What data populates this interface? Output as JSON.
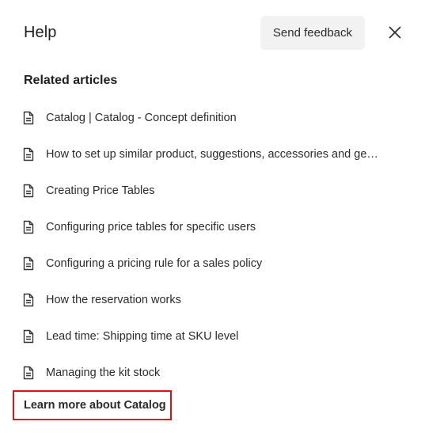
{
  "header": {
    "title": "Help",
    "feedback_label": "Send feedback",
    "close_icon": "close-icon"
  },
  "related": {
    "section_title": "Related articles",
    "items": [
      {
        "label": "Catalog | Catalog - Concept definition",
        "icon": "document-icon"
      },
      {
        "label": "How to set up similar product, suggestions, accessories and ge…",
        "icon": "document-icon"
      },
      {
        "label": "Creating Price Tables",
        "icon": "document-icon"
      },
      {
        "label": "Configuring price tables for specific users",
        "icon": "document-icon"
      },
      {
        "label": "Configuring a pricing rule for a sales policy",
        "icon": "document-icon"
      },
      {
        "label": "How the reservation works",
        "icon": "document-icon"
      },
      {
        "label": "Lead time: Shipping time at SKU level",
        "icon": "document-icon"
      },
      {
        "label": "Managing the kit stock",
        "icon": "document-icon"
      }
    ]
  },
  "footer": {
    "learn_more_label": "Learn more about Catalog",
    "highlight_color": "#e01010"
  },
  "colors": {
    "button_bg": "#f2f2f2",
    "text": "#2b2b2b"
  }
}
